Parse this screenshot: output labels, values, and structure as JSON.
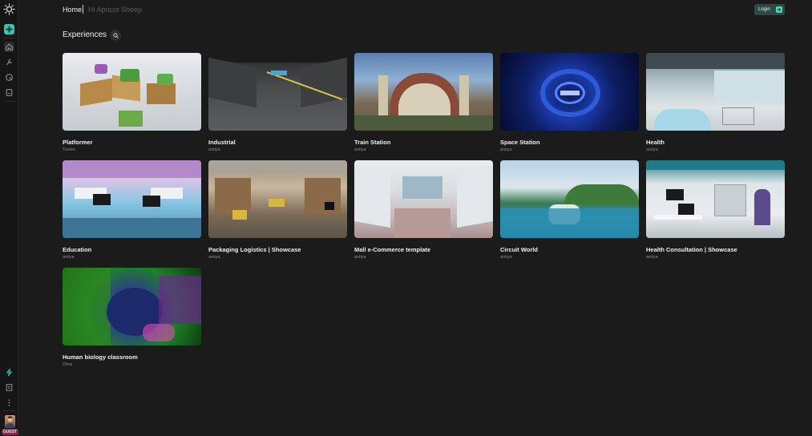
{
  "sidebar": {
    "logo_icon": "sunburst-logo-icon",
    "items": [
      {
        "icon": "plus-icon"
      },
      {
        "icon": "home-icon"
      },
      {
        "icon": "tools-icon"
      },
      {
        "icon": "paint-icon"
      },
      {
        "icon": "document-icon"
      },
      {
        "icon": "lightning-icon"
      },
      {
        "icon": "docs-icon"
      },
      {
        "icon": "more-vertical-icon"
      }
    ],
    "guest_badge": "GUEST"
  },
  "header": {
    "home_label": "Home",
    "user_label": "Hi Apricot Sheep",
    "login_label": "Login"
  },
  "main": {
    "title": "Experiences",
    "cards": [
      {
        "title": "Platformer",
        "author": "Testes"
      },
      {
        "title": "Industrial",
        "author": "anitya"
      },
      {
        "title": "Train Station",
        "author": "anitya"
      },
      {
        "title": "Space Station",
        "author": "anitya"
      },
      {
        "title": "Health",
        "author": "anitya"
      },
      {
        "title": "Education",
        "author": "anitya"
      },
      {
        "title": "Packaging Logistics | Showcase",
        "author": "anitya"
      },
      {
        "title": "Mall e-Commerce template",
        "author": "anitya"
      },
      {
        "title": "Circuit World",
        "author": "anitya"
      },
      {
        "title": "Health Consultation | Showcase",
        "author": "anitya"
      },
      {
        "title": "Human biology classroom",
        "author": "Zima"
      }
    ]
  },
  "colors": {
    "background": "#1b1b1c",
    "accent": "#3fc2a8",
    "login_bg": "#2f4a46",
    "guest_badge": "#7a2e4e"
  }
}
